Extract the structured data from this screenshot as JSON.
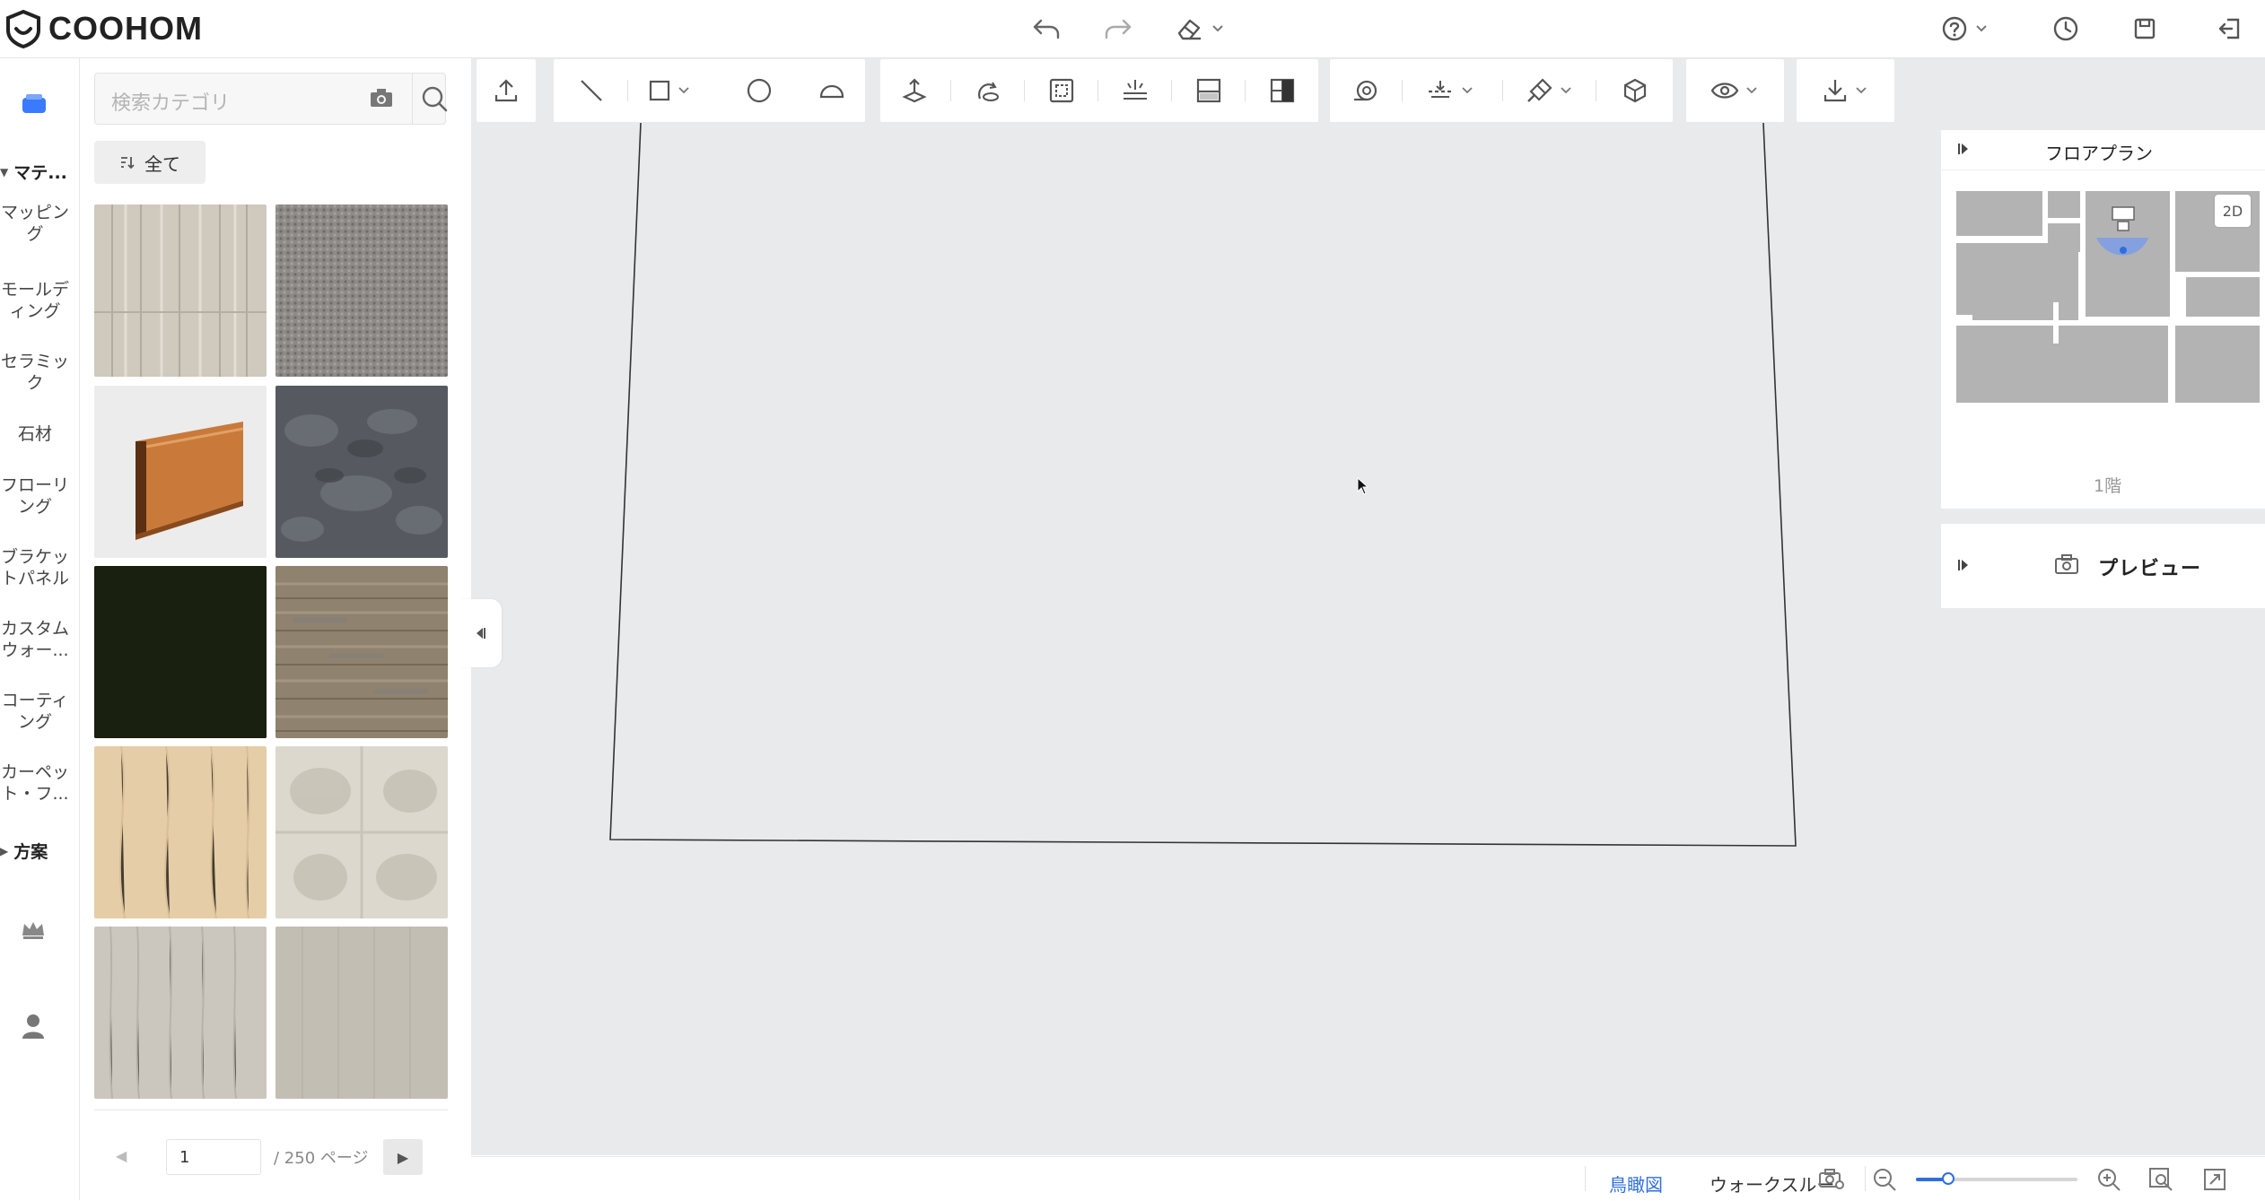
{
  "app": {
    "brand": "COOHOM"
  },
  "topbar": {
    "undo_icon": "undo-icon",
    "redo_icon": "redo-icon",
    "eraser_icon": "eraser-icon",
    "help_icon": "help-icon",
    "history_icon": "clock-icon",
    "save_icon": "save-icon",
    "exit_icon": "exit-icon"
  },
  "leftnav": {
    "sections": [
      {
        "label": "マテ..."
      },
      {
        "label": "方案"
      }
    ],
    "items": [
      {
        "label": "マッピング"
      },
      {
        "label": "モールディング"
      },
      {
        "label": "セラミック"
      },
      {
        "label": "石材"
      },
      {
        "label": "フローリング"
      },
      {
        "label": "ブラケットパネル"
      },
      {
        "label": "カスタムウォー..."
      },
      {
        "label": "コーティング"
      },
      {
        "label": "カーペット・フ..."
      }
    ]
  },
  "panel": {
    "search_placeholder": "検索カテゴリ",
    "filter_label": "全て",
    "materials": [
      {
        "name": "whitewashed-wood",
        "color": "#c9c3b8"
      },
      {
        "name": "grey-fabric",
        "color": "#8e8b88"
      },
      {
        "name": "wood-moulding",
        "color": "#ededed"
      },
      {
        "name": "dark-grey-stone",
        "color": "#5a5d63"
      },
      {
        "name": "dark-green-solid",
        "color": "#19200f"
      },
      {
        "name": "brown-oak",
        "color": "#8f826f"
      },
      {
        "name": "light-maple",
        "color": "#e5cda8"
      },
      {
        "name": "pale-marble-tile",
        "color": "#d8d4c8"
      },
      {
        "name": "light-grey-wood",
        "color": "#c8c4bc"
      },
      {
        "name": "beige-concrete",
        "color": "#c3beb3"
      }
    ],
    "pagination": {
      "current": "1",
      "total": "/ 250 ページ"
    }
  },
  "floorplan": {
    "title": "フロアプラン",
    "mode_badge": "2D",
    "floor_label": "1階"
  },
  "preview": {
    "title": "プレビュー"
  },
  "bottombar": {
    "view_birdseye": "鳥瞰図",
    "view_walkthrough": "ウォークスルー",
    "zoom_level": 0.2
  },
  "colors": {
    "accent": "#2f6fdd",
    "canvas_bg": "#e9eaeb",
    "nav_active": "#3a7afe"
  }
}
